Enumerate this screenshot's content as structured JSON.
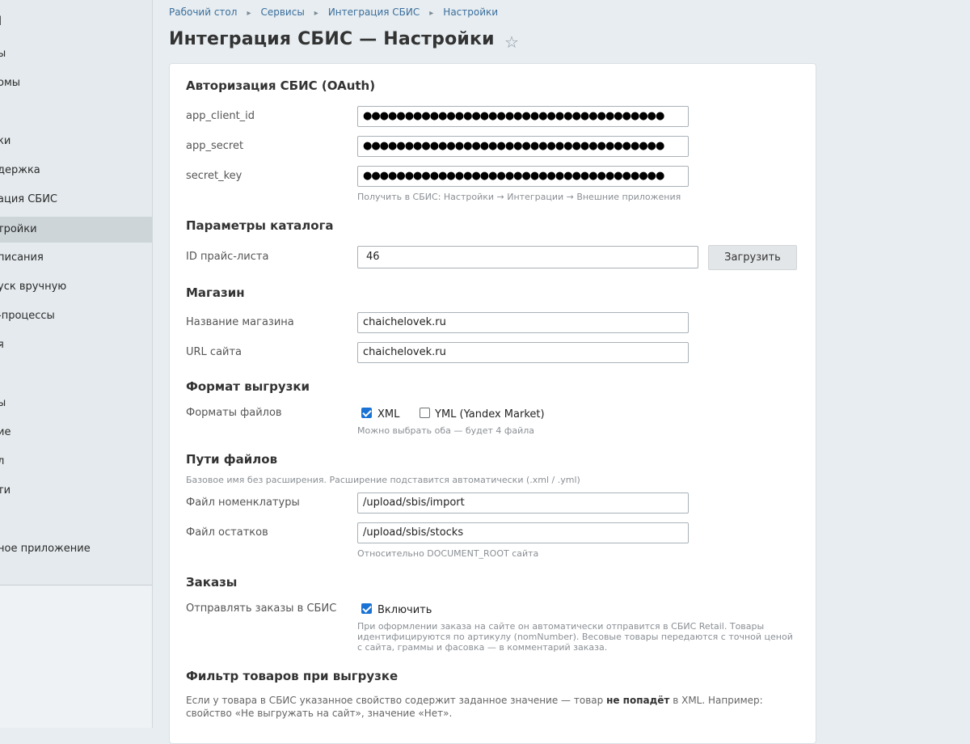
{
  "sidebar": {
    "items": [
      {
        "label": "l"
      },
      {
        "label": "ы"
      },
      {
        "label": "омы"
      },
      {
        "label": "ı"
      },
      {
        "label": "ки"
      },
      {
        "label": "держка"
      },
      {
        "label": "ация СБИС"
      },
      {
        "label": "тройки"
      },
      {
        "label": "писания"
      },
      {
        "label": "уск вручную"
      },
      {
        "label": "-процессы"
      },
      {
        "label": "я"
      },
      {
        "label": "ы"
      },
      {
        "label": "ие"
      },
      {
        "label": "л"
      },
      {
        "label": "ти"
      },
      {
        "label": "ное приложение"
      }
    ]
  },
  "breadcrumb": [
    "Рабочий стол",
    "Сервисы",
    "Интеграция СБИС",
    "Настройки"
  ],
  "page": {
    "title": "Интеграция СБИС — Настройки"
  },
  "auth": {
    "title": "Авторизация СБИС (OAuth)",
    "client_id_label": "app_client_id",
    "client_id_value": "●●●●●●●●●●●●●●●●●●●●●●●●●●●●●●●●●●●●",
    "secret_label": "app_secret",
    "secret_value": "●●●●●●●●●●●●●●●●●●●●●●●●●●●●●●●●●●●●",
    "key_label": "secret_key",
    "key_value": "●●●●●●●●●●●●●●●●●●●●●●●●●●●●●●●●●●●●",
    "hint": "Получить в СБИС: Настройки → Интеграции → Внешние приложения"
  },
  "catalog": {
    "title": "Параметры каталога",
    "price_list_label": "ID прайс-листа",
    "price_list_value": "46",
    "load_button": "Загрузить"
  },
  "shop": {
    "title": "Магазин",
    "name_label": "Название магазина",
    "name_value": "chaichelovek.ru",
    "url_label": "URL сайта",
    "url_value": "chaichelovek.ru"
  },
  "export_format": {
    "title": "Формат выгрузки",
    "label": "Форматы файлов",
    "xml_label": "XML",
    "xml_checked": true,
    "yml_label": "YML (Yandex Market)",
    "yml_checked": false,
    "hint": "Можно выбрать оба — будет 4 файла"
  },
  "paths": {
    "title": "Пути файлов",
    "hint_top": "Базовое имя без расширения. Расширение подставится автоматически (.xml / .yml)",
    "nomenclature_label": "Файл номенклатуры",
    "nomenclature_value": "/upload/sbis/import",
    "stocks_label": "Файл остатков",
    "stocks_value": "/upload/sbis/stocks",
    "hint_bottom": "Относительно DOCUMENT_ROOT сайта"
  },
  "orders": {
    "title": "Заказы",
    "label": "Отправлять заказы в СБИС",
    "enable_label": "Включить",
    "enable_checked": true,
    "hint": "При оформлении заказа на сайте он автоматически отправится в СБИС Retail. Товары идентифицируются по артикулу (nomNumber). Весовые товары передаются с точной ценой с сайта, граммы и фасовка — в комментарий заказа."
  },
  "filter": {
    "title": "Фильтр товаров при выгрузке",
    "desc_part1": "Если у товара в СБИС указанное свойство содержит заданное значение — товар ",
    "desc_bold": "не попадёт",
    "desc_part2": " в XML. Например: свойство «Не выгружать на сайт», значение «Нет»."
  }
}
